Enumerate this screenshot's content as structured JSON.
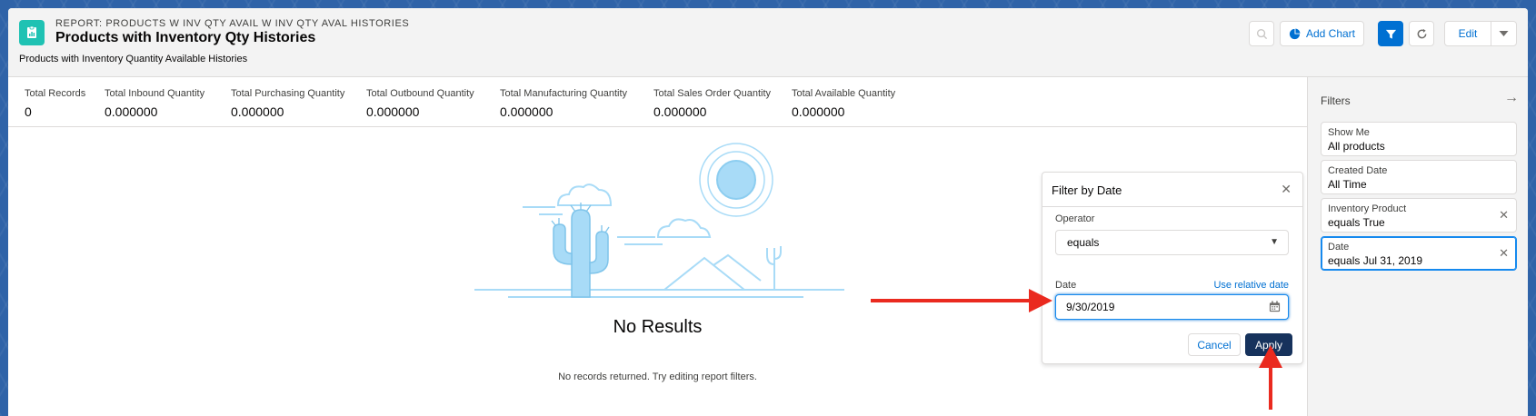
{
  "header": {
    "eyebrow": "REPORT: PRODUCTS W INV QTY AVAIL W INV QTY AVAL HISTORIES",
    "title": "Products with Inventory Qty Histories",
    "subtitle": "Products with Inventory Quantity Available Histories",
    "add_chart_label": "Add Chart",
    "edit_label": "Edit"
  },
  "summary": [
    {
      "label": "Total Records",
      "value": "0"
    },
    {
      "label": "Total Inbound Quantity",
      "value": "0.000000"
    },
    {
      "label": "Total Purchasing Quantity",
      "value": "0.000000"
    },
    {
      "label": "Total Outbound Quantity",
      "value": "0.000000"
    },
    {
      "label": "Total Manufacturing Quantity",
      "value": "0.000000"
    },
    {
      "label": "Total Sales Order Quantity",
      "value": "0.000000"
    },
    {
      "label": "Total Available Quantity",
      "value": "0.000000"
    }
  ],
  "empty_state": {
    "title": "No Results",
    "message": "No records returned. Try editing report filters."
  },
  "filters": {
    "title": "Filters",
    "items": [
      {
        "label": "Show Me",
        "value": "All products"
      },
      {
        "label": "Created Date",
        "value": "All Time"
      },
      {
        "label": "Inventory Product",
        "value": "equals True"
      },
      {
        "label": "Date",
        "value": "equals Jul 31, 2019"
      }
    ]
  },
  "popover": {
    "title": "Filter by Date",
    "operator_label": "Operator",
    "operator_value": "equals",
    "date_label": "Date",
    "relative_link": "Use relative date",
    "date_value": "9/30/2019",
    "cancel_label": "Cancel",
    "apply_label": "Apply"
  },
  "colors": {
    "brand": "#0070d2",
    "apply": "#16325c",
    "report_icon": "#1fc2b3",
    "annotation_arrow": "#ea2a1f",
    "illustration": "#a8dbf7"
  },
  "icons": {
    "report": "report-icon",
    "search": "search-icon",
    "chart": "chart-icon",
    "filter": "filter-icon",
    "refresh": "refresh-icon",
    "dropdown": "chevron-down-icon",
    "collapse": "arrow-right-icon",
    "close": "close-icon",
    "calendar": "calendar-icon"
  }
}
